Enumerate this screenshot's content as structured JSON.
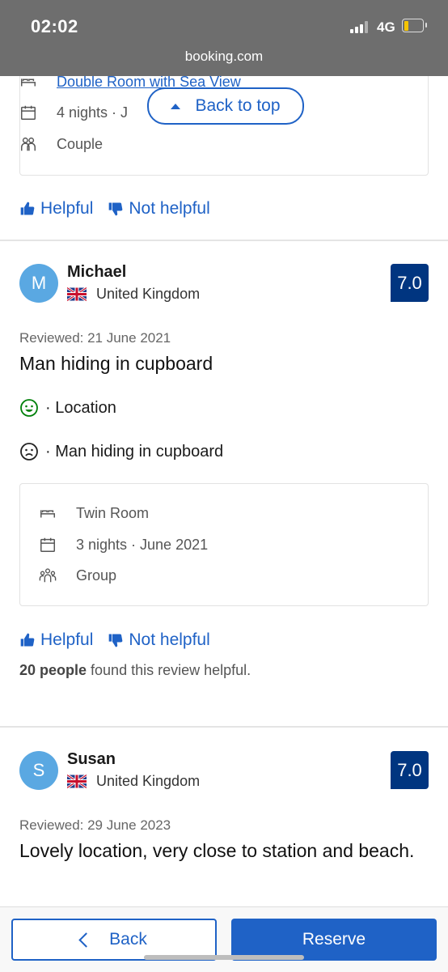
{
  "status": {
    "time": "02:02",
    "network": "4G"
  },
  "browser": {
    "domain": "booking.com"
  },
  "back_to_top": "Back to top",
  "prev_review": {
    "room": "Double Room with Sea View",
    "stay": "4 nights · J",
    "traveler": "Couple",
    "helpful": "Helpful",
    "not_helpful": "Not helpful"
  },
  "reviews": [
    {
      "initial": "M",
      "name": "Michael",
      "country": "United Kingdom",
      "score": "7.0",
      "reviewed": "Reviewed: 21 June 2021",
      "title": "Man hiding in cupboard",
      "liked": "· Location",
      "disliked": "· Man hiding in cupboard",
      "room": "Twin Room",
      "stay": "3 nights · June 2021",
      "traveler": "Group",
      "helpful": "Helpful",
      "not_helpful": "Not helpful",
      "found_count": "20 people",
      "found_text": " found this review helpful."
    },
    {
      "initial": "S",
      "name": "Susan",
      "country": "United Kingdom",
      "score": "7.0",
      "reviewed": "Reviewed: 29 June 2023",
      "title": "Lovely location, very close to station and beach."
    }
  ],
  "footer": {
    "back": "Back",
    "reserve": "Reserve"
  },
  "colors": {
    "accent": "#1f62c6",
    "score_bg": "#003580",
    "avatar": "#5aa8e2",
    "liked": "#008009"
  }
}
